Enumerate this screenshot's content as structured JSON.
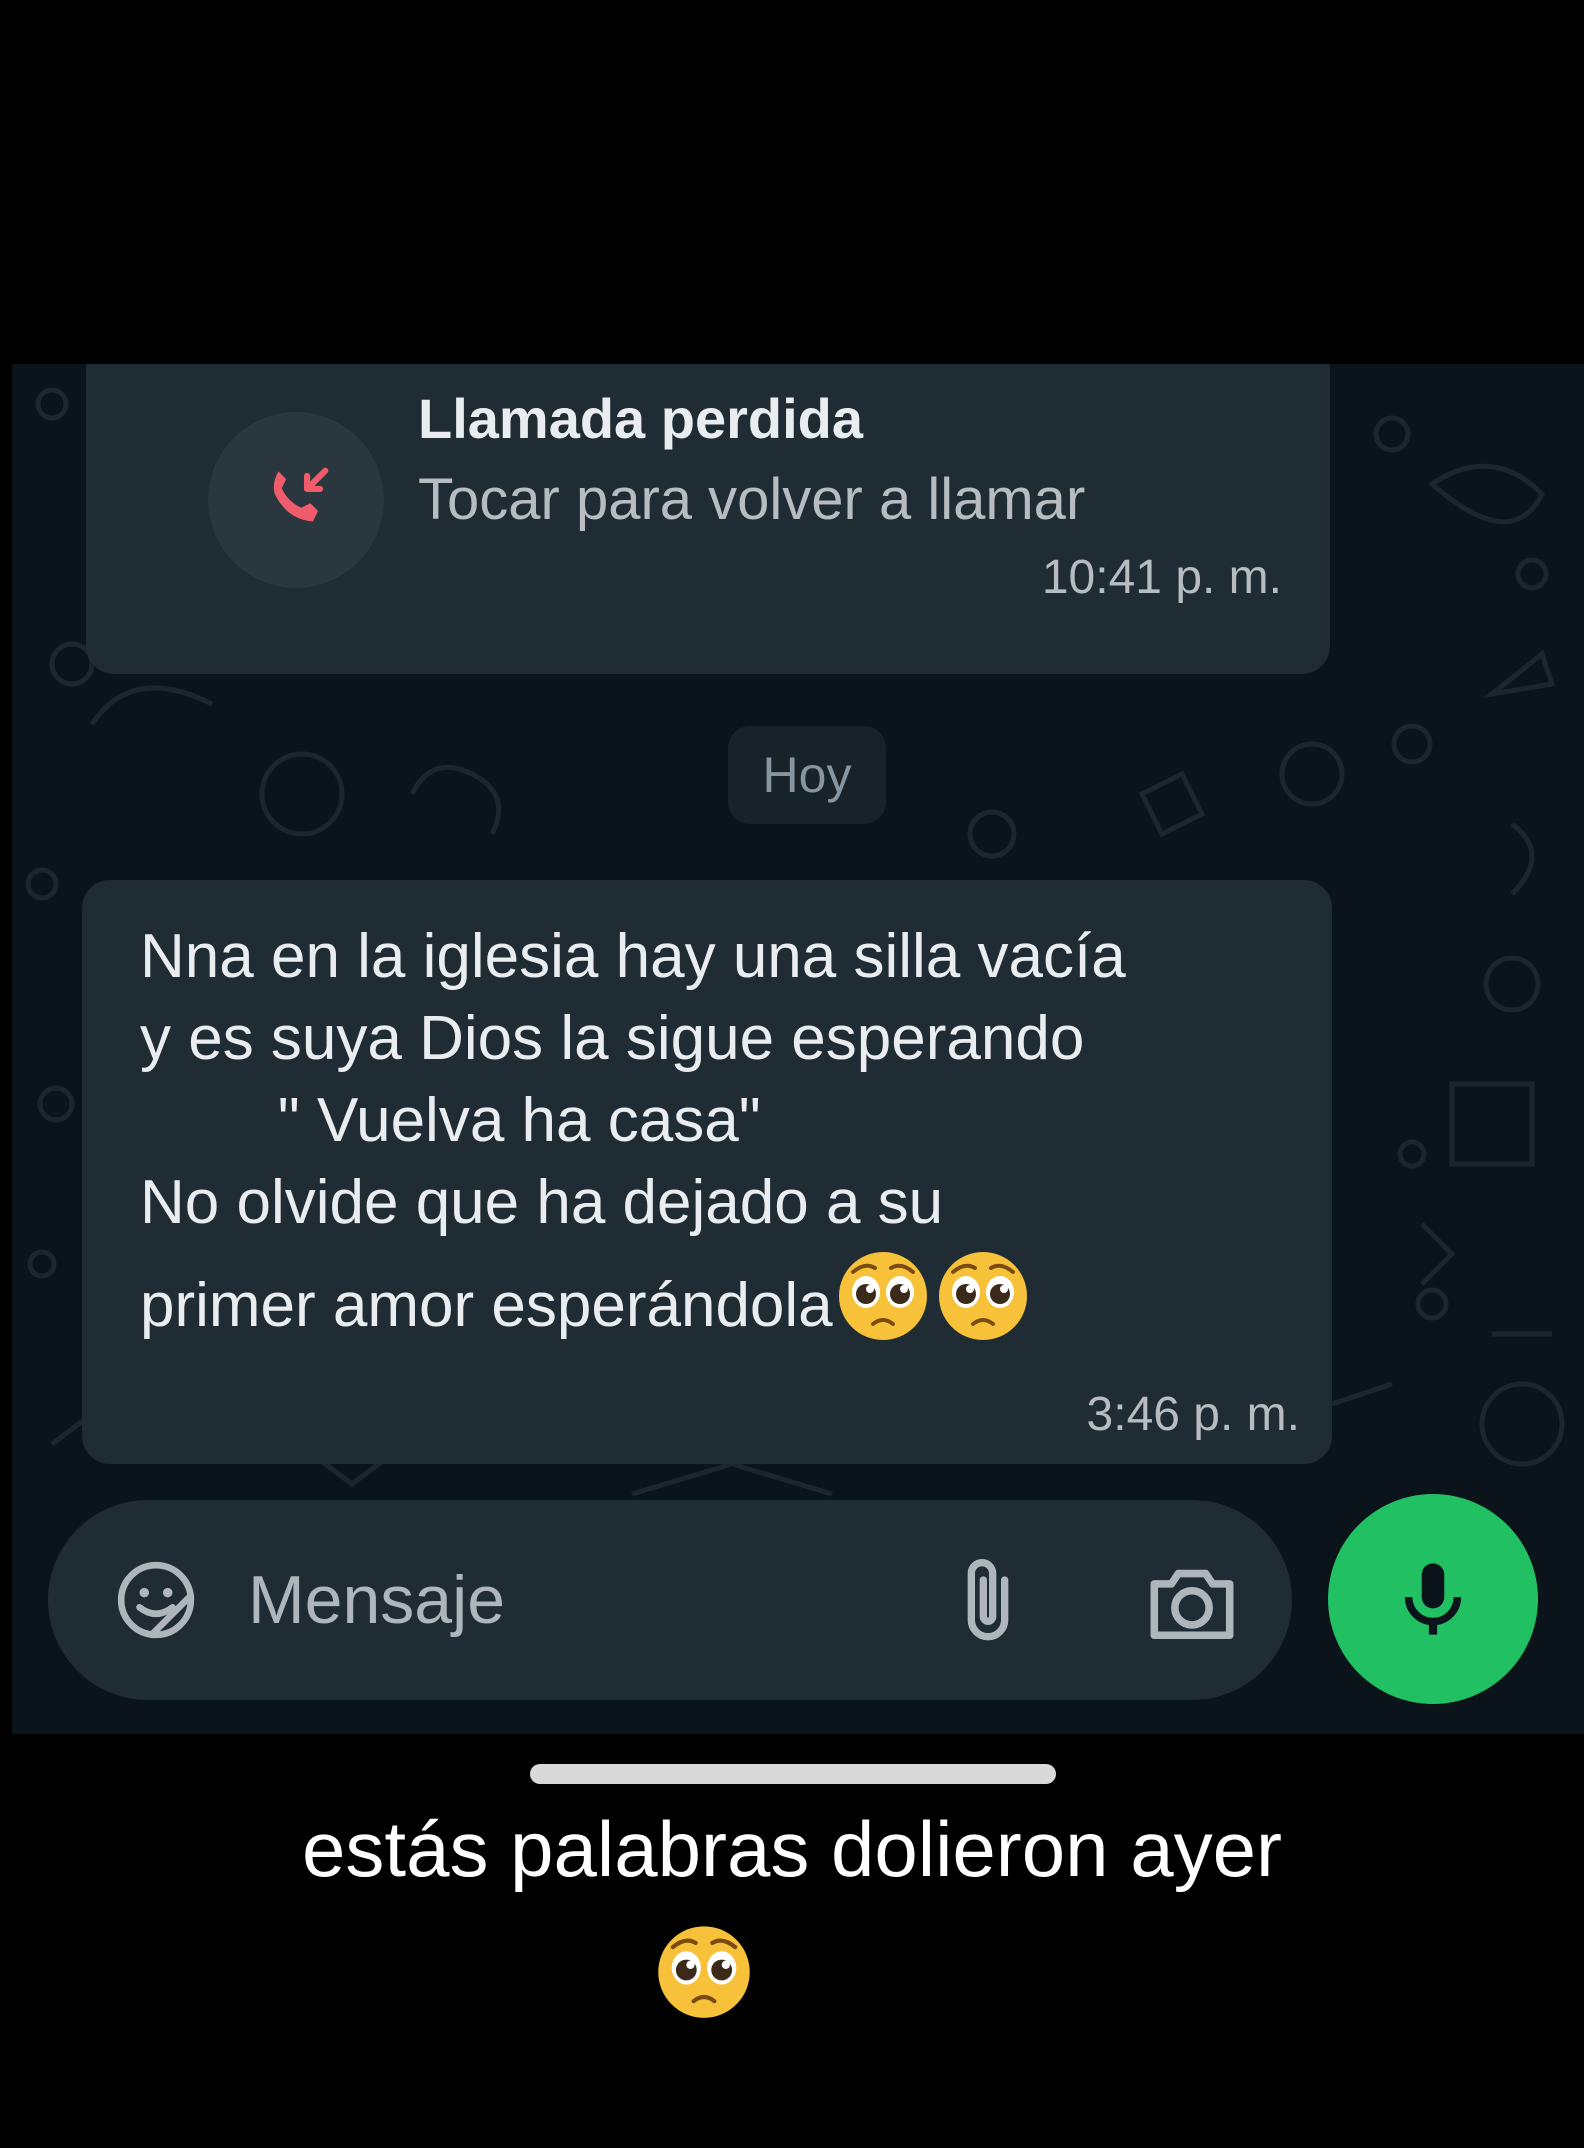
{
  "missed_call": {
    "title": "Llamada perdida",
    "subtitle": "Tocar para volver a llamar",
    "time": "10:41 p. m.",
    "icon": "missed-call-icon",
    "icon_color": "#f15c6d"
  },
  "date_separator": "Hoy",
  "message": {
    "lines": [
      "Nna en la iglesia hay una silla vacía",
      "y es suya Dios la sigue esperando",
      "        \" Vuelva ha casa\"",
      "No olvide que ha dejado a su",
      "primer amor esperándola"
    ],
    "emojis": [
      "pleading-face-emoji",
      "pleading-face-emoji"
    ],
    "time": "3:46 p. m."
  },
  "composer": {
    "placeholder": "Mensaje",
    "sticker_icon": "sticker-icon",
    "attach_icon": "paperclip-icon",
    "camera_icon": "camera-icon",
    "mic_icon": "microphone-icon",
    "mic_color": "#21c063"
  },
  "caption": {
    "text": "estás palabras dolieron ayer",
    "emoji": "pleading-face-emoji"
  },
  "colors": {
    "chat_background": "#0b141a",
    "bubble": "#1f2c33",
    "text": "#e9edef",
    "secondary_text": "#b6bcbf"
  }
}
